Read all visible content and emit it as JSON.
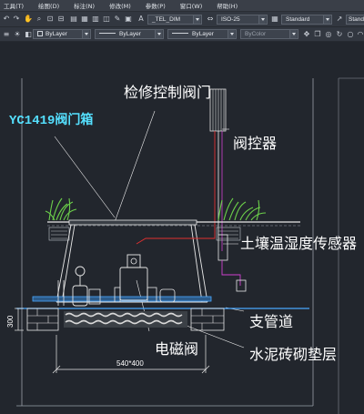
{
  "menu": {
    "items": [
      "工具(T)",
      "绘图(D)",
      "标注(N)",
      "修改(M)",
      "参数(P)",
      "窗口(W)",
      "帮助(H)"
    ]
  },
  "toolbar": {
    "dimstyle": "_TEL_DIM",
    "textstyle": "ISO-25",
    "tablestyle": "Standard",
    "tablestyle2": "Stand",
    "layer_color": "ByLayer",
    "linetype": "ByLayer",
    "lineweight": "ByLayer",
    "plotstyle": "ByColor"
  },
  "drawing": {
    "label_repair_valve": "检修控制阀门",
    "label_valve_box": "YC1419阀门箱",
    "label_valve_controller": "阀控器",
    "label_soil_sensor": "土壤温湿度传感器",
    "label_branch_pipe": "支管道",
    "label_solenoid": "电磁阀",
    "label_cement_layer": "水泥砖砌垫层",
    "dim_width": "540*400",
    "dim_height": "300"
  },
  "colors": {
    "background": "#22262d",
    "label_white": "#ffffff",
    "label_blue": "#55e0ff",
    "pipe_blue": "#4aa8ff",
    "ground_white": "#e8e8e8",
    "grass_green": "#6cd04a",
    "red": "#e03030",
    "magenta": "#d040d0"
  }
}
